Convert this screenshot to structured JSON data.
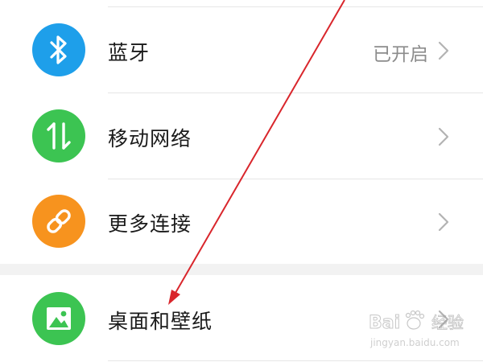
{
  "settings": {
    "items": [
      {
        "label": "蓝牙",
        "status": "已开启",
        "icon": "bluetooth-icon",
        "color": "#1e9fea"
      },
      {
        "label": "移动网络",
        "status": "",
        "icon": "mobile-data-arrows-icon",
        "color": "#3cc452"
      },
      {
        "label": "更多连接",
        "status": "",
        "icon": "link-chain-icon",
        "color": "#f7931e"
      },
      {
        "label": "桌面和壁纸",
        "status": "",
        "icon": "wallpaper-image-icon",
        "color": "#3cc452"
      }
    ]
  },
  "annotation": {
    "arrow_color": "#d9262c"
  },
  "watermark": {
    "brand": "Baidu",
    "brand_suffix": "经验",
    "url": "jingyan.baidu.com"
  }
}
